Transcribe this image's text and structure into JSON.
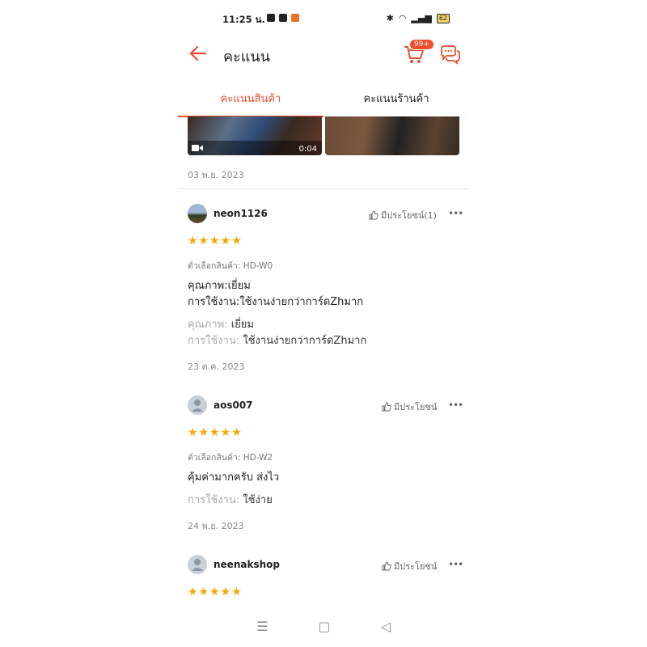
{
  "status_bar": {
    "time": "11:25 น.",
    "battery": "62"
  },
  "header": {
    "title": "คะแนน",
    "cart_badge": "99+"
  },
  "tabs": [
    {
      "label": "คะแนนสินค้า",
      "active": true
    },
    {
      "label": "คะแนนร้านค้า",
      "active": false
    }
  ],
  "prev_review": {
    "video_duration": "0:04",
    "date": "03 พ.ย. 2023"
  },
  "reviews": [
    {
      "username": "neon1126",
      "helpful_label": "มีประโยชน์(1)",
      "stars": "★★★★★",
      "variant": "ตัวเลือกสินค้า: HD-W0",
      "text_line1": "คุณภาพ:เยี่ยม",
      "text_line2": "การใช้งาน:ใช้งานง่ายกว่าการ์ดZhมาก",
      "field1_key": "คุณภาพ:",
      "field1_value": "เยี่ยม",
      "field2_key": "การใช้งาน:",
      "field2_value": "ใช้งานง่ายกว่าการ์ดZhมาก",
      "date": "23 ต.ค. 2023"
    },
    {
      "username": "aos007",
      "helpful_label": "มีประโยชน์",
      "stars": "★★★★★",
      "variant": "ตัวเลือกสินค้า: HD-W2",
      "text_line1": "คุ้มค่ามากครับ ส่งไว",
      "field1_key": "การใช้งาน:",
      "field1_value": "ใช้ง่าย",
      "date": "24 พ.ย. 2023"
    },
    {
      "username": "neenakshop",
      "helpful_label": "มีประโยชน์",
      "stars": "★★★★★"
    }
  ],
  "colors": {
    "accent": "#ee4d2d",
    "star": "#f6a700"
  }
}
